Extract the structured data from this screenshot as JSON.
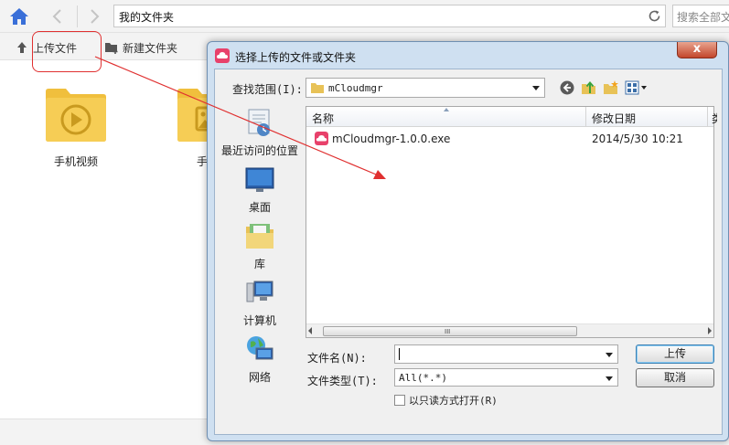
{
  "file_manager": {
    "address": "我的文件夹",
    "search_placeholder": "搜索全部文件",
    "toolbar": {
      "upload_label": "上传文件",
      "new_folder_label": "新建文件夹"
    },
    "folders": [
      {
        "label": "手机视频",
        "icon": "video-folder-icon"
      },
      {
        "label": "手机",
        "icon": "image-folder-icon"
      }
    ]
  },
  "dialog": {
    "title": "选择上传的文件或文件夹",
    "close_label": "x",
    "look_in_label": "查找范围(I):",
    "look_in_value": "mCloudmgr",
    "places": [
      {
        "label": "最近访问的位置",
        "icon": "recent-places-icon"
      },
      {
        "label": "桌面",
        "icon": "desktop-icon"
      },
      {
        "label": "库",
        "icon": "libraries-icon"
      },
      {
        "label": "计算机",
        "icon": "computer-icon"
      },
      {
        "label": "网络",
        "icon": "network-icon"
      }
    ],
    "columns": {
      "name": "名称",
      "date": "修改日期",
      "extra": "类"
    },
    "files": [
      {
        "name": "mCloudmgr-1.0.0.exe",
        "date": "2014/5/30 10:21"
      }
    ],
    "scroll_grip": "III",
    "file_name_label": "文件名(N):",
    "file_name_value": "",
    "file_type_label": "文件类型(T):",
    "file_type_value": "All(*.*)",
    "open_button": "上传",
    "cancel_button": "取消",
    "readonly_label": "以只读方式打开(R)"
  },
  "colors": {
    "home_icon": "#3a6fd8",
    "folder_yellow": "#f6cd55",
    "app_icon": "#e8416b",
    "annotation_red": "#e03030"
  }
}
